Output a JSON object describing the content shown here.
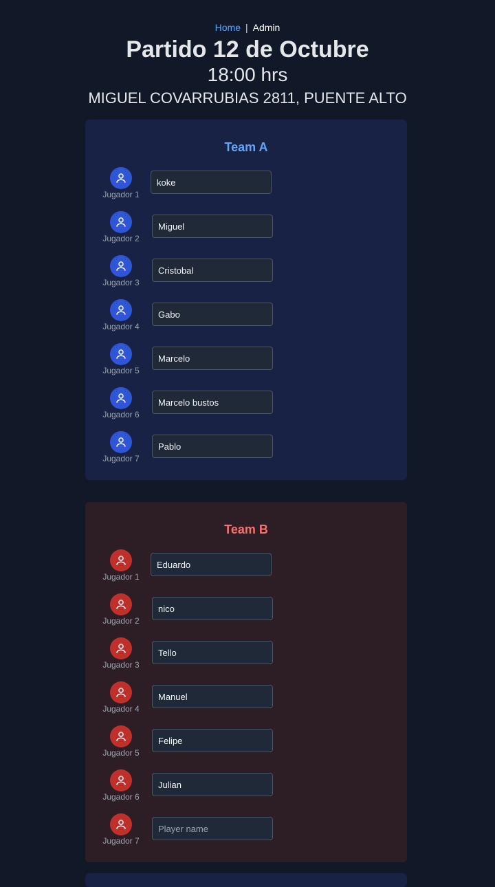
{
  "nav": {
    "home": "Home",
    "separator": "|",
    "admin": "Admin"
  },
  "match": {
    "title": "Partido 12 de Octubre",
    "time": "18:00 hrs",
    "address": "MIGUEL COVARRUBIAS 2811, PUENTE ALTO"
  },
  "teams": [
    {
      "name": "Team A",
      "accent": "#60a5fa",
      "avatar_color": "#2f56d6",
      "players": [
        {
          "label": "Jugador 1",
          "value": "koke"
        },
        {
          "label": "Jugador 2",
          "value": "Miguel"
        },
        {
          "label": "Jugador 3",
          "value": "Cristobal"
        },
        {
          "label": "Jugador 4",
          "value": "Gabo"
        },
        {
          "label": "Jugador 5",
          "value": "Marcelo"
        },
        {
          "label": "Jugador 6",
          "value": "Marcelo bustos"
        },
        {
          "label": "Jugador 7",
          "value": "Pablo"
        }
      ]
    },
    {
      "name": "Team B",
      "accent": "#f87171",
      "avatar_color": "#c0302b",
      "players": [
        {
          "label": "Jugador 1",
          "value": "Eduardo"
        },
        {
          "label": "Jugador 2",
          "value": "nico"
        },
        {
          "label": "Jugador 3",
          "value": "Tello"
        },
        {
          "label": "Jugador 4",
          "value": "Manuel"
        },
        {
          "label": "Jugador 5",
          "value": "Felipe"
        },
        {
          "label": "Jugador 6",
          "value": "Julian"
        },
        {
          "label": "Jugador 7",
          "value": "",
          "placeholder": "Player name"
        }
      ]
    }
  ],
  "icons": {
    "avatar": "user-icon"
  }
}
